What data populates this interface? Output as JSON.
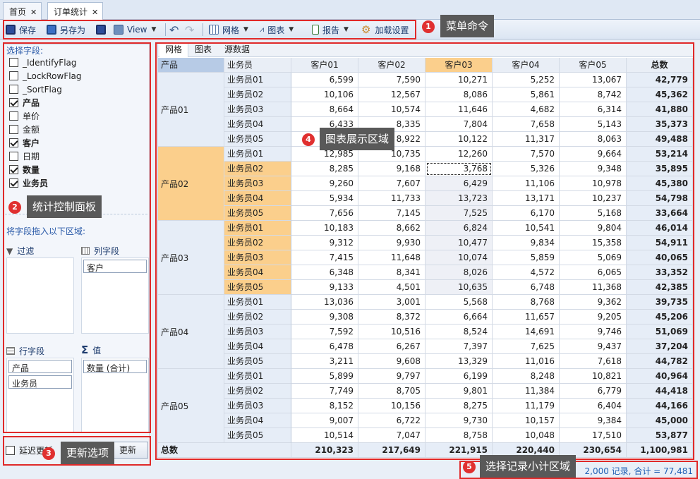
{
  "tabs": [
    {
      "label": "首页"
    },
    {
      "label": "订单统计"
    }
  ],
  "toolbar": {
    "save": "保存",
    "save_as": "另存为",
    "view": "View",
    "grid": "网格",
    "chart": "图表",
    "report": "报告",
    "load_settings": "加载设置"
  },
  "annotations": {
    "menu": {
      "num": "1",
      "text": "菜单命令"
    },
    "control": {
      "num": "2",
      "text": "统计控制面板"
    },
    "update": {
      "num": "3",
      "text": "更新选项"
    },
    "chart_area": {
      "num": "4",
      "text": "图表展示区域"
    },
    "summary": {
      "num": "5",
      "text": "选择记录小计区域"
    }
  },
  "left": {
    "select_fields": "选择字段:",
    "fields": [
      {
        "label": "_IdentifyFlag",
        "checked": false
      },
      {
        "label": "_LockRowFlag",
        "checked": false
      },
      {
        "label": "_SortFlag",
        "checked": false
      },
      {
        "label": "产品",
        "checked": true
      },
      {
        "label": "单价",
        "checked": false
      },
      {
        "label": "金额",
        "checked": false
      },
      {
        "label": "客户",
        "checked": true
      },
      {
        "label": "日期",
        "checked": false
      },
      {
        "label": "数量",
        "checked": true
      },
      {
        "label": "业务员",
        "checked": true
      }
    ],
    "drag_hint": "将字段拖入以下区域:",
    "filter": "过滤",
    "columns": "列字段",
    "column_items": [
      "客户"
    ],
    "rows": "行字段",
    "row_items": [
      "产品",
      "业务员"
    ],
    "values": "值",
    "value_items": [
      "数量 (合计)"
    ]
  },
  "update": {
    "defer": "延迟更新",
    "button": "更新"
  },
  "grid": {
    "subtabs": [
      "网格",
      "图表",
      "源数据"
    ],
    "header": {
      "product": "产品",
      "salesman": "业务员",
      "customers": [
        "客户01",
        "客户02",
        "客户03",
        "客户04",
        "客户05"
      ],
      "total": "总数"
    },
    "groups": [
      {
        "name": "产品01",
        "rows": [
          {
            "rep": "业务员01",
            "vals": [
              "6,599",
              "7,590",
              "10,271",
              "5,252",
              "13,067"
            ],
            "total": "42,779"
          },
          {
            "rep": "业务员02",
            "vals": [
              "10,106",
              "12,567",
              "8,086",
              "5,861",
              "8,742"
            ],
            "total": "45,362"
          },
          {
            "rep": "业务员03",
            "vals": [
              "8,664",
              "10,574",
              "11,646",
              "4,682",
              "6,314"
            ],
            "total": "41,880"
          },
          {
            "rep": "业务员04",
            "vals": [
              "6,433",
              "8,335",
              "7,804",
              "7,658",
              "5,143"
            ],
            "total": "35,373"
          },
          {
            "rep": "业务员05",
            "vals": [
              "",
              "8,922",
              "10,122",
              "11,317",
              "8,063"
            ],
            "total": "49,488"
          }
        ]
      },
      {
        "name": "产品02",
        "rows": [
          {
            "rep": "业务员01",
            "vals": [
              "12,985",
              "10,735",
              "12,260",
              "7,570",
              "9,664"
            ],
            "total": "53,214"
          },
          {
            "rep": "业务员02",
            "vals": [
              "8,285",
              "9,168",
              "3,768",
              "5,326",
              "9,348"
            ],
            "total": "35,895"
          },
          {
            "rep": "业务员03",
            "vals": [
              "9,260",
              "7,607",
              "6,429",
              "11,106",
              "10,978"
            ],
            "total": "45,380"
          },
          {
            "rep": "业务员04",
            "vals": [
              "5,934",
              "11,733",
              "13,723",
              "13,171",
              "10,237"
            ],
            "total": "54,798"
          },
          {
            "rep": "业务员05",
            "vals": [
              "7,656",
              "7,145",
              "7,525",
              "6,170",
              "5,168"
            ],
            "total": "33,664"
          }
        ]
      },
      {
        "name": "产品03",
        "rows": [
          {
            "rep": "业务员01",
            "vals": [
              "10,183",
              "8,662",
              "6,824",
              "10,541",
              "9,804"
            ],
            "total": "46,014"
          },
          {
            "rep": "业务员02",
            "vals": [
              "9,312",
              "9,930",
              "10,477",
              "9,834",
              "15,358"
            ],
            "total": "54,911"
          },
          {
            "rep": "业务员03",
            "vals": [
              "7,415",
              "11,648",
              "10,074",
              "5,859",
              "5,069"
            ],
            "total": "40,065"
          },
          {
            "rep": "业务员04",
            "vals": [
              "6,348",
              "8,341",
              "8,026",
              "4,572",
              "6,065"
            ],
            "total": "33,352"
          },
          {
            "rep": "业务员05",
            "vals": [
              "9,133",
              "4,501",
              "10,635",
              "6,748",
              "11,368"
            ],
            "total": "42,385"
          }
        ]
      },
      {
        "name": "产品04",
        "rows": [
          {
            "rep": "业务员01",
            "vals": [
              "13,036",
              "3,001",
              "5,568",
              "8,768",
              "9,362"
            ],
            "total": "39,735"
          },
          {
            "rep": "业务员02",
            "vals": [
              "9,308",
              "8,372",
              "6,664",
              "11,657",
              "9,205"
            ],
            "total": "45,206"
          },
          {
            "rep": "业务员03",
            "vals": [
              "7,592",
              "10,516",
              "8,524",
              "14,691",
              "9,746"
            ],
            "total": "51,069"
          },
          {
            "rep": "业务员04",
            "vals": [
              "6,478",
              "6,267",
              "7,397",
              "7,625",
              "9,437"
            ],
            "total": "37,204"
          },
          {
            "rep": "业务员05",
            "vals": [
              "3,211",
              "9,608",
              "13,329",
              "11,016",
              "7,618"
            ],
            "total": "44,782"
          }
        ]
      },
      {
        "name": "产品05",
        "rows": [
          {
            "rep": "业务员01",
            "vals": [
              "5,899",
              "9,797",
              "6,199",
              "8,248",
              "10,821"
            ],
            "total": "40,964"
          },
          {
            "rep": "业务员02",
            "vals": [
              "7,749",
              "8,705",
              "9,801",
              "11,384",
              "6,779"
            ],
            "total": "44,418"
          },
          {
            "rep": "业务员03",
            "vals": [
              "8,152",
              "10,156",
              "8,275",
              "11,179",
              "6,404"
            ],
            "total": "44,166"
          },
          {
            "rep": "业务员04",
            "vals": [
              "9,007",
              "6,722",
              "9,730",
              "10,157",
              "9,384"
            ],
            "total": "45,000"
          },
          {
            "rep": "业务员05",
            "vals": [
              "10,514",
              "7,047",
              "8,758",
              "10,048",
              "17,510"
            ],
            "total": "53,877"
          }
        ]
      }
    ],
    "grand": {
      "label": "总数",
      "vals": [
        "210,323",
        "217,649",
        "221,915",
        "220,440",
        "230,654"
      ],
      "total": "1,100,981"
    }
  },
  "status": {
    "text": "2,000 记录, 合计 = 77,481"
  },
  "colors": {
    "highlight": "#fbcf8c",
    "annotation": "#e02929",
    "callout": "#595959",
    "status_text": "#1f5fb4"
  }
}
